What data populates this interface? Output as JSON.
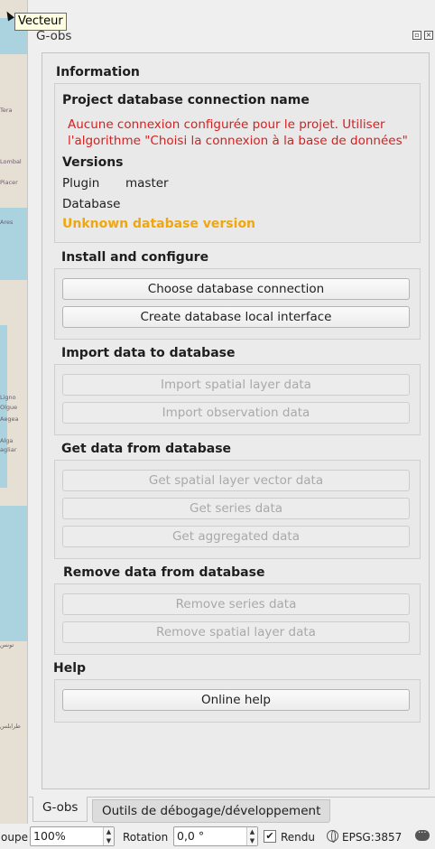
{
  "tooltip": "Vecteur",
  "map_labels": [
    "Tera",
    "Lombal",
    "Piacer",
    "Ares",
    "Ligno",
    "Olgue",
    "Aegea",
    "Alga",
    "agliar",
    "تونس",
    "طرابلس"
  ],
  "dock": {
    "title": "G-obs"
  },
  "information": {
    "title": "Information",
    "connection_title": "Project database connection name",
    "connection_error": "Aucune connexion configurée pour le projet. Utiliser l'algorithme \"Choisi la connexion à la base de données\"",
    "versions_title": "Versions",
    "plugin_label": "Plugin",
    "plugin_value": "master",
    "database_label": "Database",
    "database_warning": "Unknown database version"
  },
  "install": {
    "title": "Install and configure",
    "buttons": [
      "Choose database connection",
      "Create database local interface"
    ]
  },
  "import": {
    "title": "Import data to database",
    "buttons": [
      "Import spatial layer data",
      "Import observation data"
    ]
  },
  "get": {
    "title": "Get data from database",
    "buttons": [
      "Get spatial layer vector data",
      "Get series data",
      "Get aggregated data"
    ]
  },
  "remove": {
    "title": "Remove data from database",
    "buttons": [
      "Remove series data",
      "Remove spatial layer data"
    ]
  },
  "help": {
    "title": "Help",
    "button": "Online help"
  },
  "tabs": [
    "G-obs",
    "Outils de débogage/développement"
  ],
  "status": {
    "loupe_label": "oupe",
    "loupe_value": "100%",
    "rotation_label": "Rotation",
    "rotation_value": "0,0 °",
    "render_label": "Rendu",
    "render_checked": true,
    "epsg": "EPSG:3857"
  },
  "colors": {
    "error": "#d42020",
    "warning": "#f0a70f",
    "map_land": "#e6e0d4",
    "map_sea": "#aad3df"
  },
  "icons": {
    "float": "float-icon",
    "close": "close-icon",
    "globe": "globe-icon",
    "messages": "messages-icon",
    "cursor": "cursor-arrow-icon"
  }
}
